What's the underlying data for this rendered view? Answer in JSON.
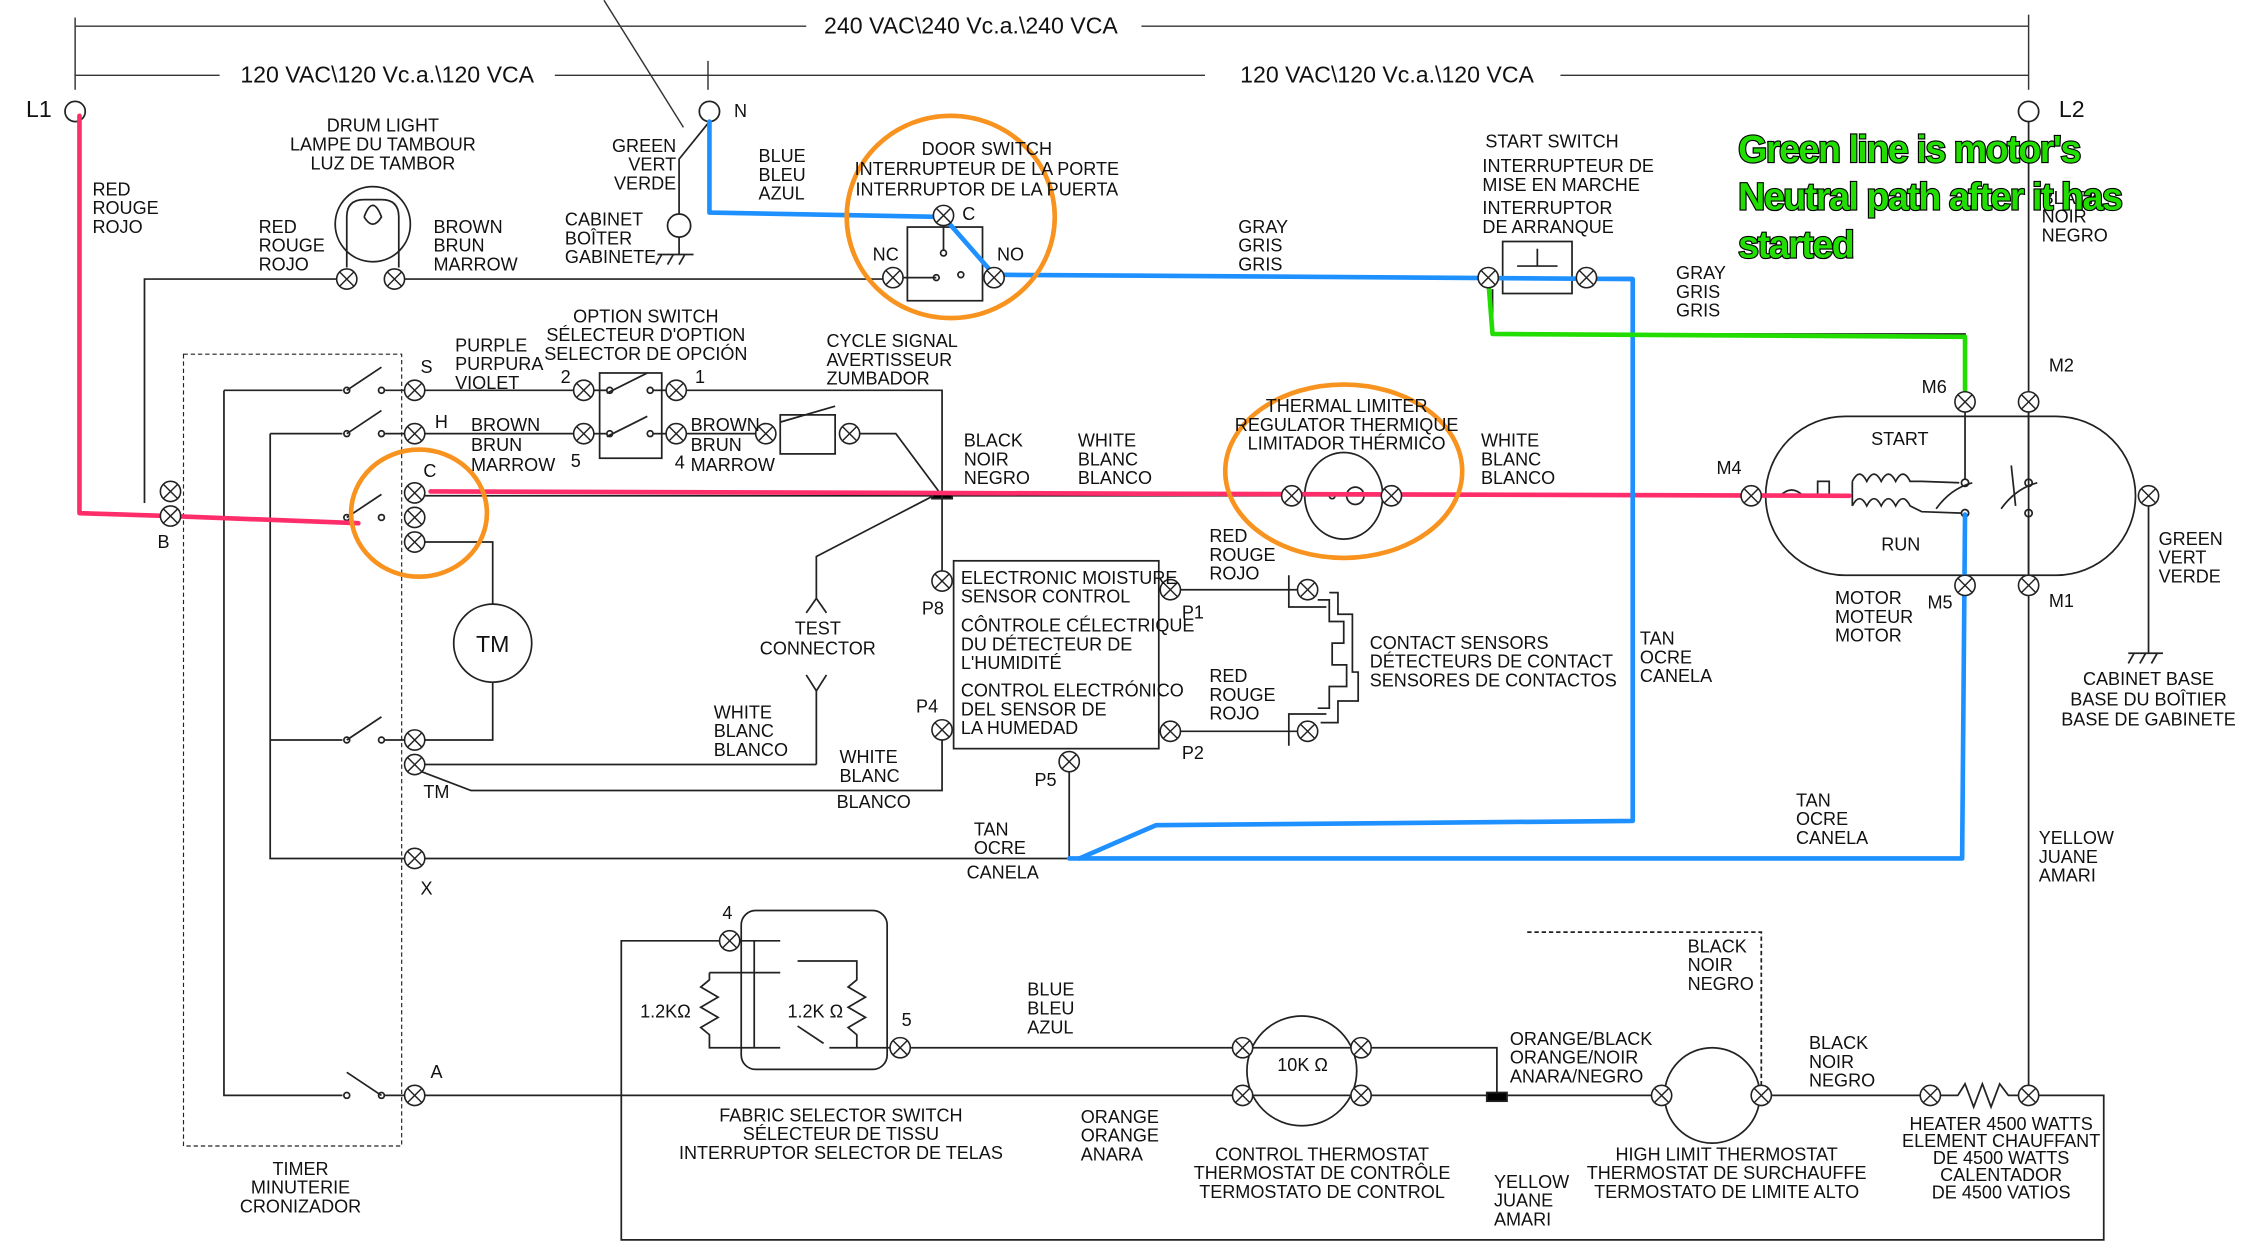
{
  "colors": {
    "hot_path": "#ff2d6a",
    "neutral_path": "#1e90ff",
    "motor_neutral_path": "#22dd00",
    "highlight_circle": "#f7931e",
    "wire": "#222222"
  },
  "annotation": {
    "lines": [
      "Green line is motor's",
      "Neutral path after it has",
      "started"
    ]
  },
  "labels": {
    "v240": [
      "240 VAC\\240 Vc.a.\\240 VCA"
    ],
    "v120_left": [
      "120 VAC\\120 Vc.a.\\120 VCA"
    ],
    "v120_right": [
      "120 VAC\\120 Vc.a.\\120 VCA"
    ],
    "l1": [
      "L1"
    ],
    "n": [
      "N"
    ],
    "l2": [
      "L2"
    ],
    "drum_light": [
      "DRUM LIGHT",
      "LAMPE DU TAMBOUR",
      "LUZ DE TAMBOR"
    ],
    "red_l1": [
      "RED",
      "ROUGE",
      "ROJO"
    ],
    "red_lamp": [
      "RED",
      "ROUGE",
      "ROJO"
    ],
    "brown_lamp": [
      "BROWN",
      "BRUN",
      "MARROW"
    ],
    "green_n": [
      "GREEN",
      "VERT",
      "VERDE"
    ],
    "cabinet": [
      "CABINET",
      "BOÎTER",
      "GABINETE"
    ],
    "blue_n": [
      "BLUE",
      "BLEU",
      "AZUL"
    ],
    "door_switch": [
      "DOOR SWITCH",
      "INTERRUPTEUR DE LA PORTE",
      "INTERRUPTOR DE LA PUERTA"
    ],
    "door_c": [
      "C"
    ],
    "door_nc": [
      "NC"
    ],
    "door_no": [
      "NO"
    ],
    "gray_1": [
      "GRAY",
      "GRIS",
      "GRIS"
    ],
    "start_switch_en": [
      "START SWITCH"
    ],
    "start_switch_fr": [
      "INTERRUPTEUR DE",
      "MISE EN MARCHE"
    ],
    "start_switch_es": [
      "INTERRUPTOR",
      "DE ARRANQUE"
    ],
    "gray_2": [
      "GRAY",
      "GRIS",
      "GRIS"
    ],
    "black_l2": [
      "BLACK",
      "NOIR",
      "NEGRO"
    ],
    "purple": [
      "PURPLE",
      "PURPURA",
      "VIOLET"
    ],
    "timer_s": [
      "S"
    ],
    "timer_h": [
      "H"
    ],
    "timer_c": [
      "C"
    ],
    "timer_b": [
      "B"
    ],
    "timer_tm": [
      "TM"
    ],
    "timer_x": [
      "X"
    ],
    "timer_a": [
      "A"
    ],
    "option_switch": [
      "OPTION SWITCH",
      "SÉLECTEUR D'OPTION",
      "SELECTOR DE OPCIÓN"
    ],
    "opt_2": [
      "2"
    ],
    "opt_1": [
      "1"
    ],
    "opt_5": [
      "5"
    ],
    "opt_4": [
      "4"
    ],
    "cycle_signal": [
      "CYCLE SIGNAL",
      "AVERTISSEUR",
      "ZUMBADOR"
    ],
    "brown_h": [
      "BROWN",
      "BRUN",
      "MARROW"
    ],
    "brown_buzzer": [
      "BROWN",
      "BRUN",
      "MARROW"
    ],
    "black_junction": [
      "BLACK",
      "NOIR",
      "NEGRO"
    ],
    "white_1": [
      "WHITE",
      "BLANC",
      "BLANCO"
    ],
    "thermal_limiter": [
      "THERMAL LIMITER",
      "REGULATOR THERMIQUE",
      "LIMITADOR THÉRMICO"
    ],
    "white_2": [
      "WHITE",
      "BLANC",
      "BLANCO"
    ],
    "m4": [
      "M4"
    ],
    "m6": [
      "M6"
    ],
    "m2": [
      "M2"
    ],
    "m5": [
      "M5"
    ],
    "m1": [
      "M1"
    ],
    "motor_start": [
      "START"
    ],
    "motor_run": [
      "RUN"
    ],
    "motor": [
      "MOTOR",
      "MOTEUR",
      "MOTOR"
    ],
    "green_motor": [
      "GREEN",
      "VERT",
      "VERDE"
    ],
    "cabinet_base": [
      "CABINET BASE",
      "BASE DU BOÎTIER",
      "BASE DE GABINETE"
    ],
    "tm_motor": [
      "TM"
    ],
    "test_connector": [
      "TEST",
      "CONNECTOR"
    ],
    "emsc_en": [
      "ELECTRONIC MOISTURE",
      "SENSOR CONTROL"
    ],
    "emsc_fr": [
      "CÔNTROLE CÉLECTRIQUE",
      "DU DÉTECTEUR DE",
      "L'HUMIDITÉ"
    ],
    "emsc_es": [
      "CONTROL ELECTRÓNICO",
      "DEL SENSOR DE",
      "LA HUMEDAD"
    ],
    "p8": [
      "P8"
    ],
    "p4": [
      "P4"
    ],
    "p5": [
      "P5"
    ],
    "p1": [
      "P1"
    ],
    "p2": [
      "P2"
    ],
    "red_p1": [
      "RED",
      "ROUGE",
      "ROJO"
    ],
    "red_p2": [
      "RED",
      "ROUGE",
      "ROJO"
    ],
    "contact_sensors": [
      "CONTACT SENSORS",
      "DÉTECTEURS DE CONTACT",
      "SENSORES DE CONTACTOS"
    ],
    "tan_1": [
      "TAN",
      "OCRE",
      "CANELA"
    ],
    "white_3": [
      "WHITE",
      "BLANC",
      "BLANCO"
    ],
    "white_4": [
      "WHITE",
      "BLANC"
    ],
    "white_4b": [
      "BLANCO"
    ],
    "tan_2": [
      "TAN",
      "OCRE"
    ],
    "tan_2b": [
      "CANELA"
    ],
    "tan_3": [
      "TAN",
      "OCRE",
      "CANELA"
    ],
    "yellow_1": [
      "YELLOW",
      "JUANE",
      "AMARI"
    ],
    "fab_4": [
      "4"
    ],
    "fab_5": [
      "5"
    ],
    "res_left": [
      "1.2KΩ"
    ],
    "res_right": [
      "1.2K Ω"
    ],
    "blue_2": [
      "BLUE",
      "BLEU",
      "AZUL"
    ],
    "fabric_selector": [
      "FABRIC SELECTOR SWITCH",
      "SÉLECTEUR DE TISSU",
      "INTERRUPTOR SELECTOR DE TELAS"
    ],
    "orange": [
      "ORANGE",
      "ORANGE",
      "ANARA"
    ],
    "res_10k": [
      "10K Ω"
    ],
    "control_thermostat": [
      "CONTROL THERMOSTAT",
      "THERMOSTAT DE CONTRÔLE",
      "TERMOSTATO DE CONTROL"
    ],
    "orange_black": [
      "ORANGE/BLACK",
      "ORANGE/NOIR",
      "ANARA/NEGRO"
    ],
    "black_dashed": [
      "BLACK",
      "NOIR",
      "NEGRO"
    ],
    "black_heater": [
      "BLACK",
      "NOIR",
      "NEGRO"
    ],
    "high_limit": [
      "HIGH LIMIT THERMOSTAT",
      "THERMOSTAT DE SURCHAUFFE",
      "TERMOSTATO DE LIMITE ALTO"
    ],
    "heater": [
      "HEATER 4500 WATTS",
      "ELEMENT CHAUFFANT",
      "DE 4500 WATTS",
      "CALENTADOR",
      "DE 4500 VATIOS"
    ],
    "yellow_2": [
      "YELLOW",
      "JUANE",
      "AMARI"
    ],
    "timer": [
      "TIMER",
      "MINUTERIE",
      "CRONIZADOR"
    ]
  }
}
